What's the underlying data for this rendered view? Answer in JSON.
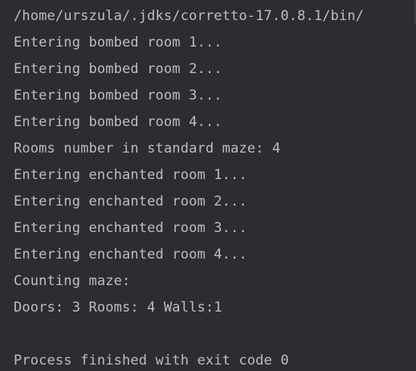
{
  "console": {
    "lines": [
      "/home/urszula/.jdks/corretto-17.0.8.1/bin/",
      "Entering bombed room 1...",
      "Entering bombed room 2...",
      "Entering bombed room 3...",
      "Entering bombed room 4...",
      "Rooms number in standard maze: 4",
      "Entering enchanted room 1...",
      "Entering enchanted room 2...",
      "Entering enchanted room 3...",
      "Entering enchanted room 4...",
      "Counting maze:",
      "Doors: 3 Rooms: 4 Walls:1",
      "",
      "Process finished with exit code 0"
    ]
  }
}
